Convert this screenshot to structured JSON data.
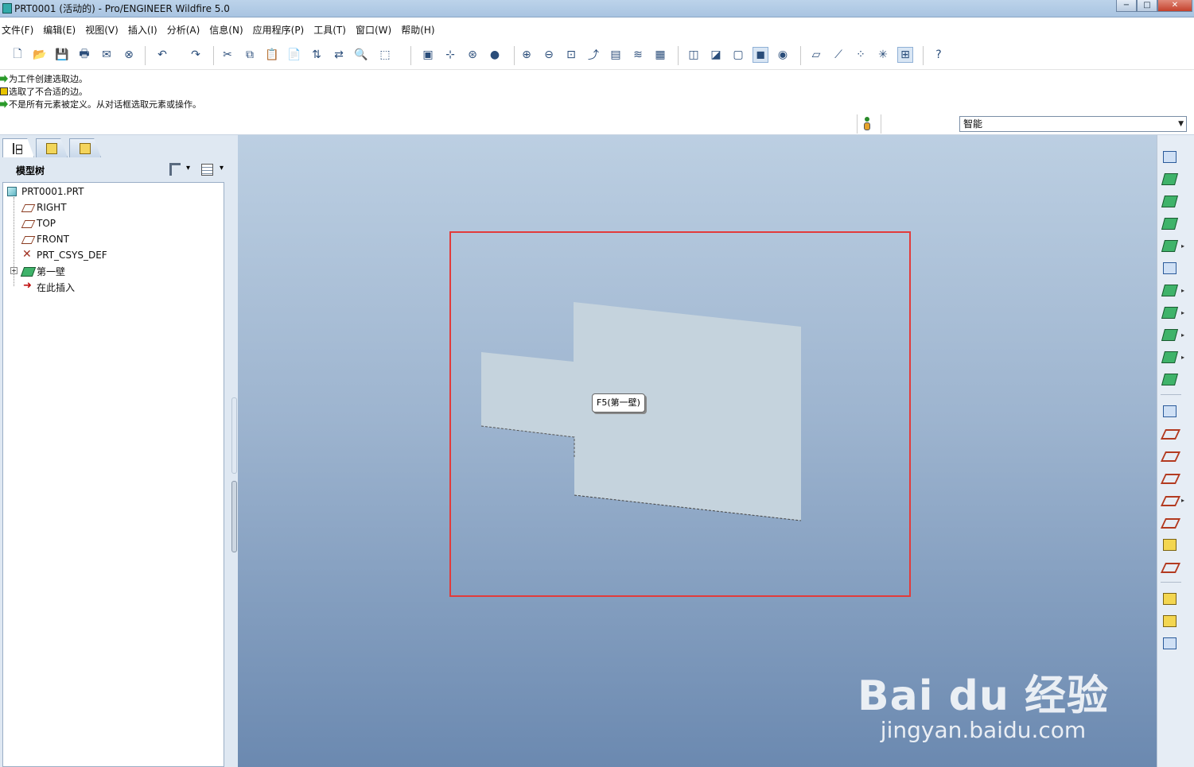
{
  "window": {
    "title": "PRT0001 (活动的) - Pro/ENGINEER Wildfire 5.0",
    "controls": [
      "−",
      "□",
      "✕"
    ]
  },
  "menu": [
    "文件(F)",
    "编辑(E)",
    "视图(V)",
    "插入(I)",
    "分析(A)",
    "信息(N)",
    "应用程序(P)",
    "工具(T)",
    "窗口(W)",
    "帮助(H)"
  ],
  "toolbar": {
    "buttons": [
      {
        "name": "new-icon",
        "glyph": "🗋"
      },
      {
        "name": "open-icon",
        "glyph": "📂"
      },
      {
        "name": "save-icon",
        "glyph": "💾"
      },
      {
        "name": "print-icon",
        "glyph": "🖶"
      },
      {
        "name": "send-icon",
        "glyph": "✉"
      },
      {
        "name": "close-window-icon",
        "glyph": "⊗"
      },
      {
        "name": "undo-icon",
        "glyph": "↶"
      },
      {
        "name": "redo-icon",
        "glyph": "↷"
      },
      {
        "name": "cut-icon",
        "glyph": "✂"
      },
      {
        "name": "copy-icon",
        "glyph": "⧉"
      },
      {
        "name": "paste-icon",
        "glyph": "📋"
      },
      {
        "name": "paste-special-icon",
        "glyph": "📄"
      },
      {
        "name": "regenerate-icon",
        "glyph": "⇅"
      },
      {
        "name": "regen-manager-icon",
        "glyph": "⇄"
      },
      {
        "name": "find-icon",
        "glyph": "🔍"
      },
      {
        "name": "selection-box-icon",
        "glyph": "⬚"
      },
      {
        "name": "repaint-icon",
        "glyph": "▣"
      },
      {
        "name": "spin-center-icon",
        "glyph": "⊹"
      },
      {
        "name": "orient-icon",
        "glyph": "⊛"
      },
      {
        "name": "appearance-icon",
        "glyph": "●"
      },
      {
        "name": "zoom-in-icon",
        "glyph": "⊕"
      },
      {
        "name": "zoom-out-icon",
        "glyph": "⊖"
      },
      {
        "name": "refit-icon",
        "glyph": "⊡"
      },
      {
        "name": "reorient-icon",
        "glyph": "⤴"
      },
      {
        "name": "saved-views-icon",
        "glyph": "▤"
      },
      {
        "name": "layers-icon",
        "glyph": "≋"
      },
      {
        "name": "view-manager-icon",
        "glyph": "▦"
      },
      {
        "name": "wireframe-icon",
        "glyph": "◫"
      },
      {
        "name": "hidden-line-icon",
        "glyph": "◪"
      },
      {
        "name": "no-hidden-icon",
        "glyph": "▢"
      },
      {
        "name": "shading-icon",
        "glyph": "◼"
      },
      {
        "name": "enhanced-realism-icon",
        "glyph": "◉"
      },
      {
        "name": "datum-planes-icon",
        "glyph": "▱"
      },
      {
        "name": "datum-axes-icon",
        "glyph": "⟋"
      },
      {
        "name": "datum-points-icon",
        "glyph": "⁘"
      },
      {
        "name": "csys-icon",
        "glyph": "✳"
      },
      {
        "name": "annotation-icon",
        "glyph": "⊞"
      },
      {
        "name": "context-help-icon",
        "glyph": "?"
      }
    ]
  },
  "messages": [
    {
      "type": "arrow",
      "text": "为工件创建选取边。"
    },
    {
      "type": "warn",
      "text": "选取了不合适的边。"
    },
    {
      "type": "arrow",
      "text": "不是所有元素被定义。从对话框选取元素或操作。"
    }
  ],
  "filter": {
    "value": "智能"
  },
  "model_tree": {
    "title": "模型树",
    "items": [
      {
        "icon": "part",
        "label": "PRT0001.PRT"
      },
      {
        "icon": "plane",
        "label": "RIGHT"
      },
      {
        "icon": "plane",
        "label": "TOP"
      },
      {
        "icon": "plane",
        "label": "FRONT"
      },
      {
        "icon": "csys",
        "label": "PRT_CSYS_DEF"
      },
      {
        "icon": "wall",
        "label": "第一壁"
      },
      {
        "icon": "insert",
        "label": "在此插入"
      }
    ]
  },
  "graphics": {
    "tooltip": "F5(第一壁)",
    "watermark_logo": "Bai du 经验",
    "watermark_url": "jingyan.baidu.com",
    "colors": {
      "bg_top": "#bccfe2",
      "bg_bottom": "#6b89b0",
      "surface": "#c5d3dd",
      "selection": "#e23b3b"
    }
  }
}
